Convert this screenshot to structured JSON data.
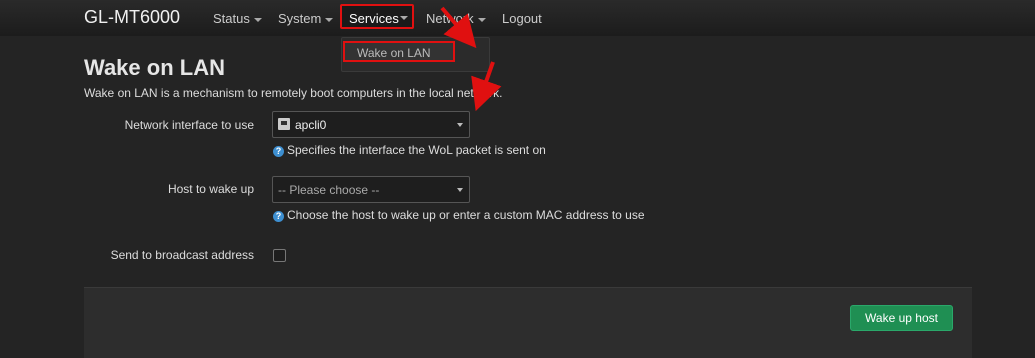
{
  "nav": {
    "brand": "GL-MT6000",
    "items": [
      {
        "label": "Status",
        "has_caret": true
      },
      {
        "label": "System",
        "has_caret": true
      },
      {
        "label": "Services",
        "has_caret": true,
        "active": true
      },
      {
        "label": "Network",
        "has_caret": true
      },
      {
        "label": "Logout",
        "has_caret": false
      }
    ],
    "services_dropdown": [
      "Wake on LAN"
    ]
  },
  "page": {
    "title": "Wake on LAN",
    "description": "Wake on LAN is a mechanism to remotely boot computers in the local network."
  },
  "form": {
    "interface": {
      "label": "Network interface to use",
      "value": "apcli0",
      "hint": "Specifies the interface the WoL packet is sent on"
    },
    "host": {
      "label": "Host to wake up",
      "placeholder": "-- Please choose --",
      "hint": "Choose the host to wake up or enter a custom MAC address to use"
    },
    "broadcast": {
      "label": "Send to broadcast address",
      "checked": false
    }
  },
  "actions": {
    "wake_label": "Wake up host"
  },
  "colors": {
    "highlight": "#e01010",
    "primary_button": "#1f8f53",
    "help_icon": "#3d8fd1"
  }
}
